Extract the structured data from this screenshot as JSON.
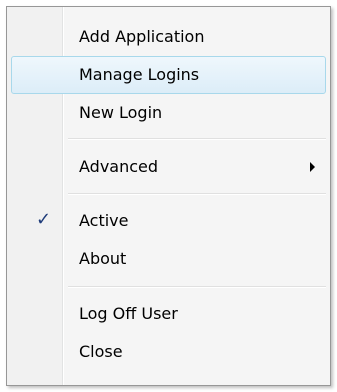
{
  "menu": {
    "items": {
      "add_application": {
        "label": "Add Application"
      },
      "manage_logins": {
        "label": "Manage Logins"
      },
      "new_login": {
        "label": "New Login"
      },
      "advanced": {
        "label": "Advanced"
      },
      "active": {
        "label": "Active",
        "checked": true
      },
      "about": {
        "label": "About"
      },
      "log_off_user": {
        "label": "Log Off User"
      },
      "close": {
        "label": "Close"
      }
    },
    "check_glyph": "✓",
    "highlighted_item": "Manage Logins",
    "colors": {
      "highlight_border": "#a8d8eb",
      "highlight_fill": "#dcedf8",
      "check": "#1f3c7a"
    },
    "icons": {
      "submenu": "chevron-right-icon",
      "checked": "checkmark-icon"
    }
  }
}
